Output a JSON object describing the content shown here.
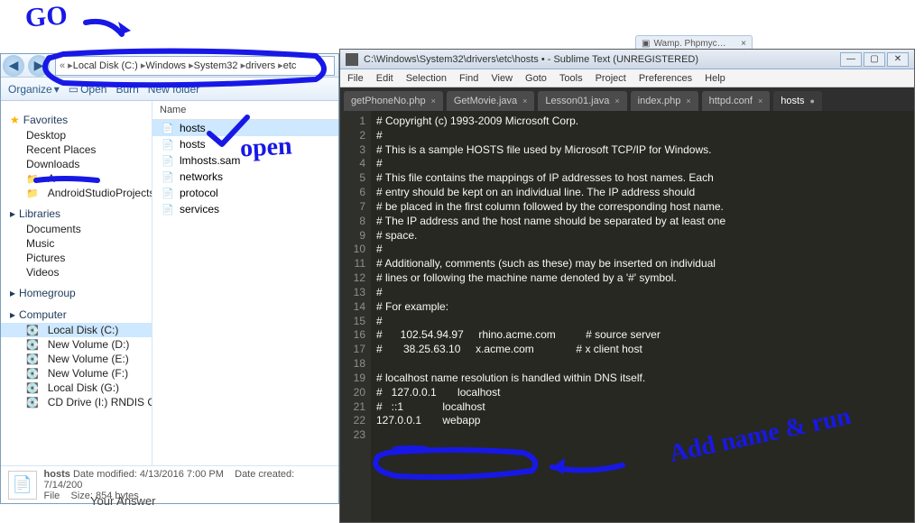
{
  "annotations": {
    "go": "GO",
    "open": "open",
    "add": "Add name & run"
  },
  "browserTab": "Wamp. Phpmyc…",
  "answerLabel": "Your Answer",
  "explorer": {
    "breadcrumb": [
      "Local Disk (C:)",
      "Windows",
      "System32",
      "drivers",
      "etc"
    ],
    "toolbar": {
      "organize": "Organize",
      "open": "Open",
      "burn": "Burn",
      "newFolder": "New folder"
    },
    "sidebar": {
      "favorites": {
        "label": "Favorites",
        "items": [
          "Desktop",
          "Recent Places",
          "Downloads",
          "A",
          "AndroidStudioProjects"
        ]
      },
      "libraries": {
        "label": "Libraries",
        "items": [
          "Documents",
          "Music",
          "Pictures",
          "Videos"
        ]
      },
      "homegroup": {
        "label": "Homegroup"
      },
      "computer": {
        "label": "Computer",
        "items": [
          "Local Disk (C:)",
          "New Volume (D:)",
          "New Volume (E:)",
          "New Volume (F:)",
          "Local Disk (G:)",
          "CD Drive (I:) RNDIS CD"
        ]
      }
    },
    "files": {
      "header": "Name",
      "rows": [
        "hosts",
        "hosts",
        "lmhosts.sam",
        "networks",
        "protocol",
        "services"
      ]
    },
    "status": {
      "name": "hosts",
      "dateMod": "Date modified: 4/13/2016 7:00 PM",
      "created": "Date created: 7/14/200",
      "type": "File",
      "size": "Size: 854 bytes"
    }
  },
  "sublime": {
    "title": "C:\\Windows\\System32\\drivers\\etc\\hosts • - Sublime Text (UNREGISTERED)",
    "menu": [
      "File",
      "Edit",
      "Selection",
      "Find",
      "View",
      "Goto",
      "Tools",
      "Project",
      "Preferences",
      "Help"
    ],
    "tabs": [
      {
        "label": "getPhoneNo.php"
      },
      {
        "label": "GetMovie.java"
      },
      {
        "label": "Lesson01.java"
      },
      {
        "label": "index.php"
      },
      {
        "label": "httpd.conf"
      },
      {
        "label": "hosts",
        "active": true,
        "dirty": true
      }
    ],
    "lines": [
      "# Copyright (c) 1993-2009 Microsoft Corp.",
      "#",
      "# This is a sample HOSTS file used by Microsoft TCP/IP for Windows.",
      "#",
      "# This file contains the mappings of IP addresses to host names. Each",
      "# entry should be kept on an individual line. The IP address should",
      "# be placed in the first column followed by the corresponding host name.",
      "# The IP address and the host name should be separated by at least one",
      "# space.",
      "#",
      "# Additionally, comments (such as these) may be inserted on individual",
      "# lines or following the machine name denoted by a '#' symbol.",
      "#",
      "# For example:",
      "#",
      "#      102.54.94.97     rhino.acme.com          # source server",
      "#       38.25.63.10     x.acme.com              # x client host",
      "",
      "# localhost name resolution is handled within DNS itself.",
      "#   127.0.0.1       localhost",
      "#   ::1             localhost",
      "127.0.0.1       webapp",
      ""
    ]
  }
}
